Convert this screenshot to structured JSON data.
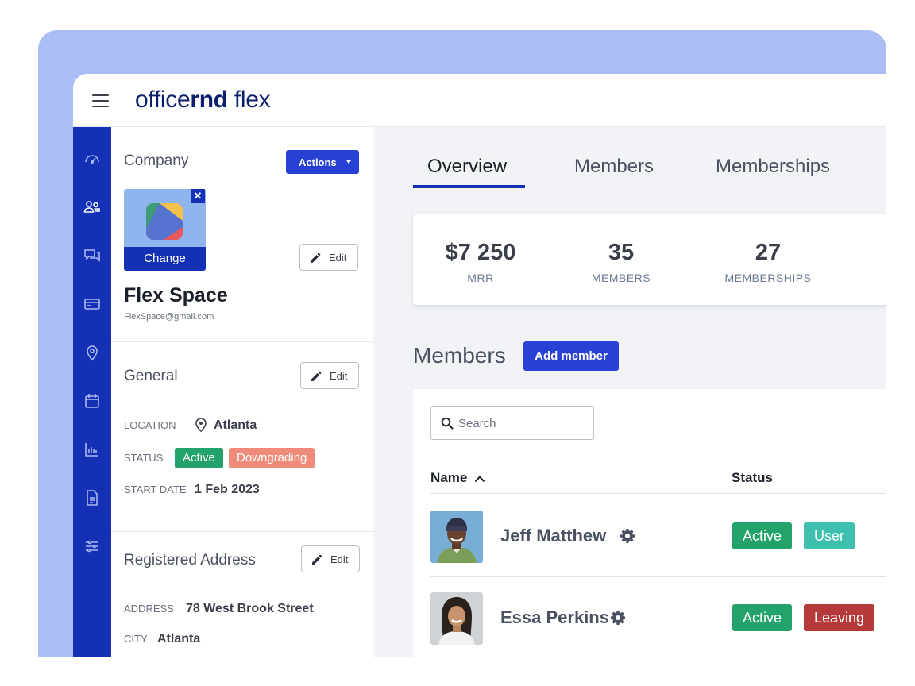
{
  "app": {
    "logo_light_1": "office",
    "logo_bold": "rnd",
    "logo_light_2": " flex"
  },
  "sidebar": {
    "icons": [
      "dashboard-icon",
      "members-icon",
      "messages-icon",
      "billing-icon",
      "location-icon",
      "calendar-icon",
      "reports-icon",
      "document-icon",
      "settings-sliders-icon"
    ]
  },
  "company": {
    "section_title": "Company",
    "actions_label": "Actions",
    "change_label": "Change",
    "close_glyph": "✕",
    "edit_label": "Edit",
    "name": "Flex Space",
    "email": "FlexSpace@gmail.com"
  },
  "general": {
    "section_title": "General",
    "edit_label": "Edit",
    "location_label": "LOCATION",
    "location_value": "Atlanta",
    "status_label": "STATUS",
    "status_badges": [
      "Active",
      "Downgrading"
    ],
    "start_label": "START DATE",
    "start_value": "1 Feb 2023"
  },
  "address": {
    "section_title": "Registered Address",
    "edit_label": "Edit",
    "address_label": "ADDRESS",
    "address_value": "78 West Brook Street",
    "city_label": "CITY",
    "city_value": "Atlanta"
  },
  "tabs": [
    "Overview",
    "Members",
    "Memberships"
  ],
  "stats": [
    {
      "value": "$7 250",
      "label": "MRR"
    },
    {
      "value": "35",
      "label": "MEMBERS"
    },
    {
      "value": "27",
      "label": "MEMBERSHIPS"
    }
  ],
  "members": {
    "title": "Members",
    "add_label": "Add member",
    "search_placeholder": "Search",
    "columns": {
      "name": "Name",
      "status": "Status"
    },
    "rows": [
      {
        "name": "Jeff Matthew",
        "badges": [
          "Active",
          "User"
        ]
      },
      {
        "name": "Essa Perkins",
        "badges": [
          "Active",
          "Leaving"
        ]
      }
    ]
  },
  "colors": {
    "active": "#23a26c",
    "downgrading": "#f08a7b",
    "user": "#3fbfae",
    "leaving": "#b63a3a",
    "primary": "#2840d4",
    "nav": "#1431b5"
  }
}
